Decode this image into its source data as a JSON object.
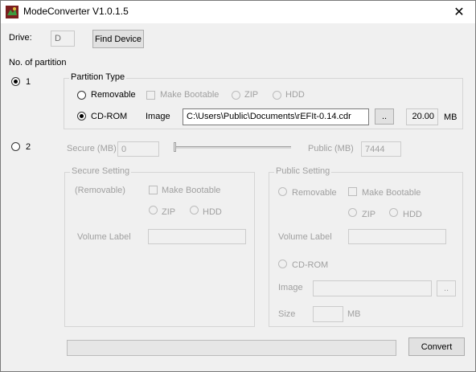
{
  "window": {
    "title": "ModeConverter V1.0.1.5",
    "close_glyph": "✕"
  },
  "drive": {
    "label": "Drive:",
    "value": "D",
    "find_button": "Find Device"
  },
  "partitions": {
    "label": "No. of partition",
    "option1": "1",
    "option2": "2"
  },
  "partition_type": {
    "group_label": "Partition Type",
    "removable": "Removable",
    "make_bootable": "Make Bootable",
    "zip": "ZIP",
    "hdd": "HDD",
    "cdrom": "CD-ROM",
    "image_label": "Image",
    "image_path": "C:\\Users\\Public\\Documents\\rEFIt-0.14.cdr",
    "browse_button": "..",
    "size_value": "20.00",
    "size_unit": "MB"
  },
  "split": {
    "secure_label": "Secure (MB)",
    "secure_value": "0",
    "public_label": "Public (MB)",
    "public_value": "7444"
  },
  "secure_setting": {
    "group_label": "Secure Setting",
    "removable": "(Removable)",
    "make_bootable": "Make Bootable",
    "zip": "ZIP",
    "hdd": "HDD",
    "volume_label": "Volume Label",
    "volume_value": ""
  },
  "public_setting": {
    "group_label": "Public Setting",
    "removable": "Removable",
    "make_bootable": "Make Bootable",
    "zip": "ZIP",
    "hdd": "HDD",
    "volume_label": "Volume Label",
    "volume_value": "",
    "cdrom": "CD-ROM",
    "image_label": "Image",
    "image_value": "",
    "browse_button": "..",
    "size_label": "Size",
    "size_value": "",
    "size_unit": "MB"
  },
  "footer": {
    "convert_button": "Convert"
  }
}
